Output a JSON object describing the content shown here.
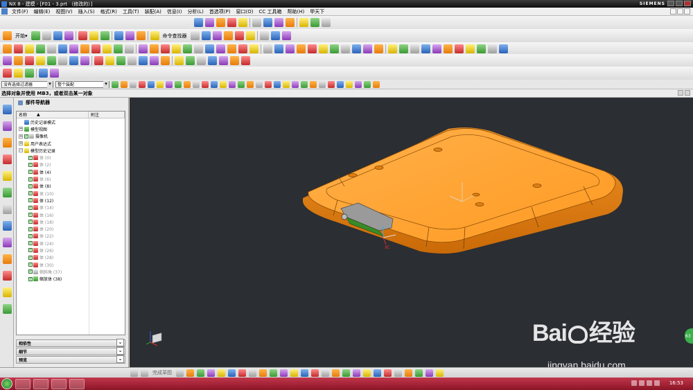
{
  "window": {
    "title": "NX 8 - 建模 - [F01 - 3.prt （修改的）]",
    "brand": "SIEMENS"
  },
  "menu": {
    "items": [
      "文件(F)",
      "编辑(E)",
      "视图(V)",
      "插入(S)",
      "格式(R)",
      "工具(T)",
      "装配(A)",
      "信息(I)",
      "分析(L)",
      "首选项(P)",
      "窗口(O)",
      "CC 工具箱",
      "帮助(H)",
      "甲天下"
    ]
  },
  "toolbar": {
    "start_label": "开始▾",
    "command_finder_label": "命令查找器"
  },
  "selection": {
    "filter_value": "没有选择过滤器",
    "scope_value": "整个装配"
  },
  "status": {
    "prompt": "选择对象并使用 MB3，或者双击某一对象"
  },
  "navigator": {
    "title": "部件导航器",
    "col_name": "名称",
    "col_note": "附注",
    "sort_glyph": "▲",
    "items": [
      {
        "label": "历史记录模式",
        "level": 0,
        "expand": "",
        "check": false,
        "icon": "clock-icon",
        "dim": false
      },
      {
        "label": "模型视图",
        "level": 0,
        "expand": "+",
        "check": false,
        "icon": "model-views-icon",
        "dim": false
      },
      {
        "label": "摄像机",
        "level": 0,
        "expand": "+",
        "check": true,
        "icon": "camera-icon",
        "dim": false
      },
      {
        "label": "用户表达式",
        "level": 0,
        "expand": "+",
        "check": false,
        "icon": "folder-icon",
        "dim": false
      },
      {
        "label": "模型历史记录",
        "level": 0,
        "expand": "−",
        "check": false,
        "icon": "folder-open-icon",
        "dim": false
      },
      {
        "label": "体 (0)",
        "level": 1,
        "expand": "",
        "check": true,
        "icon": "body-icon",
        "dim": true
      },
      {
        "label": "体 (2)",
        "level": 1,
        "expand": "",
        "check": true,
        "icon": "body-icon",
        "dim": true
      },
      {
        "label": "体 (4)",
        "level": 1,
        "expand": "",
        "check": true,
        "icon": "body-icon",
        "dim": false
      },
      {
        "label": "体 (6)",
        "level": 1,
        "expand": "",
        "check": true,
        "icon": "body-icon",
        "dim": true
      },
      {
        "label": "体 (8)",
        "level": 1,
        "expand": "",
        "check": true,
        "icon": "body-icon",
        "dim": false
      },
      {
        "label": "体 (10)",
        "level": 1,
        "expand": "",
        "check": true,
        "icon": "body-icon",
        "dim": true
      },
      {
        "label": "体 (12)",
        "level": 1,
        "expand": "",
        "check": true,
        "icon": "body-icon",
        "dim": false
      },
      {
        "label": "体 (14)",
        "level": 1,
        "expand": "",
        "check": true,
        "icon": "body-icon",
        "dim": true
      },
      {
        "label": "体 (16)",
        "level": 1,
        "expand": "",
        "check": true,
        "icon": "body-icon",
        "dim": true
      },
      {
        "label": "体 (18)",
        "level": 1,
        "expand": "",
        "check": true,
        "icon": "body-icon",
        "dim": true
      },
      {
        "label": "体 (20)",
        "level": 1,
        "expand": "",
        "check": true,
        "icon": "body-icon",
        "dim": true
      },
      {
        "label": "体 (22)",
        "level": 1,
        "expand": "",
        "check": true,
        "icon": "body-icon",
        "dim": true
      },
      {
        "label": "体 (24)",
        "level": 1,
        "expand": "",
        "check": true,
        "icon": "body-icon",
        "dim": true
      },
      {
        "label": "体 (26)",
        "level": 1,
        "expand": "",
        "check": true,
        "icon": "body-icon",
        "dim": true
      },
      {
        "label": "体 (28)",
        "level": 1,
        "expand": "",
        "check": true,
        "icon": "body-icon",
        "dim": true
      },
      {
        "label": "体 (30)",
        "level": 1,
        "expand": "",
        "check": true,
        "icon": "body-icon",
        "dim": true
      },
      {
        "label": "倒斜角 (37)",
        "level": 1,
        "expand": "",
        "check": true,
        "icon": "chamfer-icon",
        "dim": true
      },
      {
        "label": "缩放体 (38)",
        "level": 1,
        "expand": "",
        "check": true,
        "icon": "scale-body-icon",
        "dim": false
      }
    ],
    "panels": [
      "相依性",
      "细节",
      "预览"
    ]
  },
  "viewport": {
    "axis_label": "XC",
    "badge": "63"
  },
  "bottom_toolbar": {
    "sketch_label": "完成草图"
  },
  "taskbar": {
    "clock": "16:53"
  },
  "watermark": {
    "brand": "Bai",
    "brand2": "经验",
    "url": "jingyan.baidu.com"
  },
  "colors": {
    "part_orange": "#f08a1d",
    "viewport_bg": "#2b2e33",
    "taskbar": "#a82036"
  }
}
